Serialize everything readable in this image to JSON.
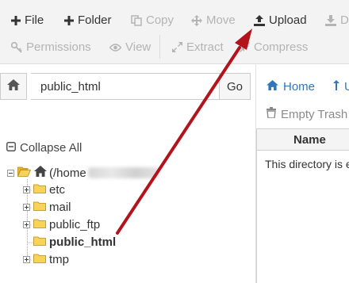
{
  "toolbar": {
    "row1": [
      {
        "label": "File",
        "icon": "plus-icon",
        "enabled": true
      },
      {
        "label": "Folder",
        "icon": "plus-icon",
        "enabled": true
      },
      {
        "label": "Copy",
        "icon": "copy-icon",
        "enabled": false
      },
      {
        "label": "Move",
        "icon": "move-icon",
        "enabled": false
      },
      {
        "label": "Upload",
        "icon": "upload-icon",
        "enabled": true
      },
      {
        "label": "D",
        "icon": "download-icon",
        "enabled": false
      }
    ],
    "row2": [
      {
        "label": "Permissions",
        "icon": "key-icon",
        "enabled": false
      },
      {
        "label": "View",
        "icon": "eye-icon",
        "enabled": false
      },
      {
        "label": "Extract",
        "icon": "expand-icon",
        "enabled": false
      },
      {
        "label": "Compress",
        "icon": "compress-icon",
        "enabled": false
      }
    ]
  },
  "address_bar": {
    "home_icon": "home-icon",
    "path_value": "public_html",
    "go_label": "Go"
  },
  "nav": {
    "home_label": "Home",
    "up_label": "U",
    "empty_trash_label": "Empty Trash"
  },
  "file_list": {
    "header_name": "Name",
    "empty_message": "This directory is e"
  },
  "tree": {
    "collapse_all_label": "Collapse All",
    "root_label": "(/home",
    "items": [
      {
        "label": "etc",
        "expandable": true,
        "selected": false
      },
      {
        "label": "mail",
        "expandable": true,
        "selected": false
      },
      {
        "label": "public_ftp",
        "expandable": true,
        "selected": false
      },
      {
        "label": "public_html",
        "expandable": false,
        "selected": true
      },
      {
        "label": "tmp",
        "expandable": true,
        "selected": false
      }
    ]
  },
  "colors": {
    "toolbar_bg": "#f3f3f3",
    "link_blue": "#2f78b8",
    "disabled_gray": "#b4b4b4",
    "arrow_red": "#b3141c",
    "folder_yellow": "#f5c842"
  }
}
